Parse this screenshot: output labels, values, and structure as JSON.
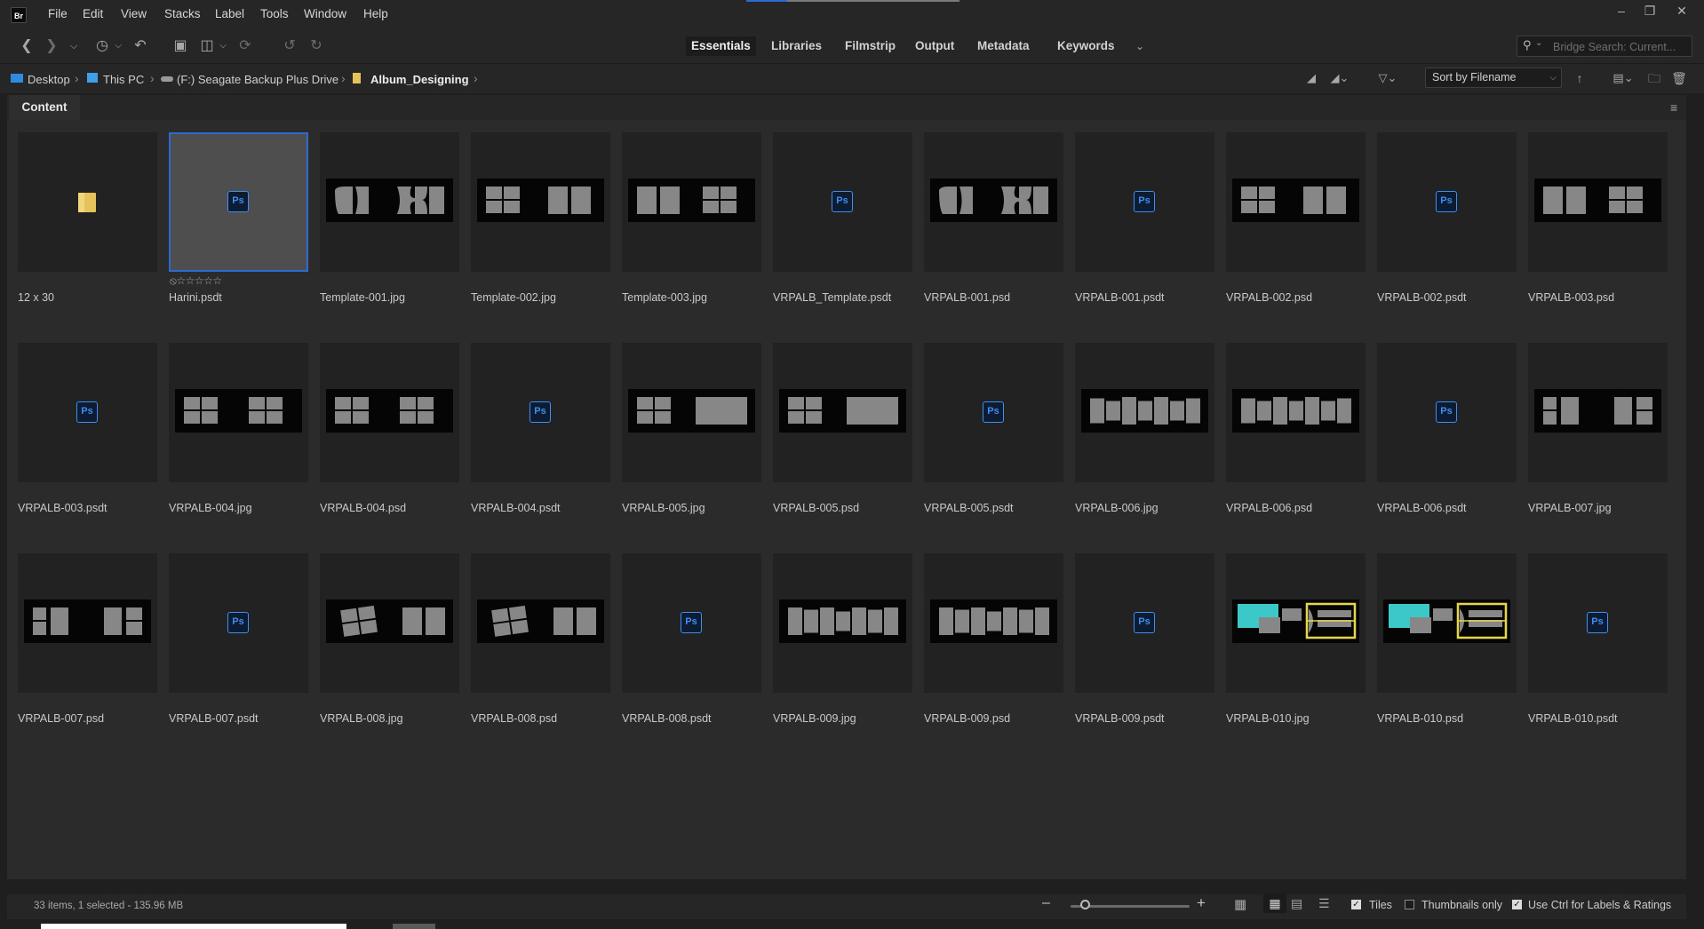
{
  "app": {
    "logo": "Br",
    "window_controls": [
      "minimize-icon",
      "restore-icon",
      "close-icon"
    ]
  },
  "menu": [
    "File",
    "Edit",
    "View",
    "Stacks",
    "Label",
    "Tools",
    "Window",
    "Help"
  ],
  "workspaces": [
    "Essentials",
    "Libraries",
    "Filmstrip",
    "Output",
    "Metadata",
    "Keywords"
  ],
  "active_workspace": "Essentials",
  "search": {
    "placeholder": "Bridge Search: Current..."
  },
  "breadcrumb": {
    "items": [
      "Desktop",
      "This PC",
      "(F:) Seagate Backup Plus Drive",
      "Album_Designing"
    ]
  },
  "sort": {
    "label": "Sort by Filename"
  },
  "panel": {
    "tab": "Content"
  },
  "files": [
    {
      "name": "12 x 30",
      "type": "folder"
    },
    {
      "name": "Harini.psdt",
      "type": "ps",
      "selected": true,
      "rating": "⦸☆☆☆☆☆"
    },
    {
      "name": "Template-001.jpg",
      "type": "t1"
    },
    {
      "name": "Template-002.jpg",
      "type": "t2"
    },
    {
      "name": "Template-003.jpg",
      "type": "t3"
    },
    {
      "name": "VRPALB_Template.psdt",
      "type": "ps"
    },
    {
      "name": "VRPALB-001.psd",
      "type": "t1"
    },
    {
      "name": "VRPALB-001.psdt",
      "type": "ps"
    },
    {
      "name": "VRPALB-002.psd",
      "type": "t2"
    },
    {
      "name": "VRPALB-002.psdt",
      "type": "ps"
    },
    {
      "name": "VRPALB-003.psd",
      "type": "t3"
    },
    {
      "name": "VRPALB-003.psdt",
      "type": "ps"
    },
    {
      "name": "VRPALB-004.jpg",
      "type": "t4"
    },
    {
      "name": "VRPALB-004.psd",
      "type": "t4"
    },
    {
      "name": "VRPALB-004.psdt",
      "type": "ps"
    },
    {
      "name": "VRPALB-005.jpg",
      "type": "t5"
    },
    {
      "name": "VRPALB-005.psd",
      "type": "t5"
    },
    {
      "name": "VRPALB-005.psdt",
      "type": "ps"
    },
    {
      "name": "VRPALB-006.jpg",
      "type": "t6"
    },
    {
      "name": "VRPALB-006.psd",
      "type": "t6"
    },
    {
      "name": "VRPALB-006.psdt",
      "type": "ps"
    },
    {
      "name": "VRPALB-007.jpg",
      "type": "t7"
    },
    {
      "name": "VRPALB-007.psd",
      "type": "t7"
    },
    {
      "name": "VRPALB-007.psdt",
      "type": "ps"
    },
    {
      "name": "VRPALB-008.jpg",
      "type": "t8"
    },
    {
      "name": "VRPALB-008.psd",
      "type": "t8"
    },
    {
      "name": "VRPALB-008.psdt",
      "type": "ps"
    },
    {
      "name": "VRPALB-009.jpg",
      "type": "t9"
    },
    {
      "name": "VRPALB-009.psd",
      "type": "t9"
    },
    {
      "name": "VRPALB-009.psdt",
      "type": "ps"
    },
    {
      "name": "VRPALB-010.jpg",
      "type": "t10"
    },
    {
      "name": "VRPALB-010.psd",
      "type": "t10"
    },
    {
      "name": "VRPALB-010.psdt",
      "type": "ps"
    }
  ],
  "status": {
    "text": "33 items, 1 selected - 135.96 MB",
    "zoom_level": 0.12,
    "options": [
      {
        "label": "Tiles",
        "checked": true
      },
      {
        "label": "Thumbnails only",
        "checked": false
      },
      {
        "label": "Use Ctrl for Labels & Ratings",
        "checked": true
      }
    ]
  },
  "colors": {
    "accent": "#2d6ad3",
    "ps_blue": "#3d8ef0",
    "background": "#2b2b2b",
    "highlight_cyan": "#3cc8c8",
    "highlight_yellow": "#e8d64a"
  }
}
